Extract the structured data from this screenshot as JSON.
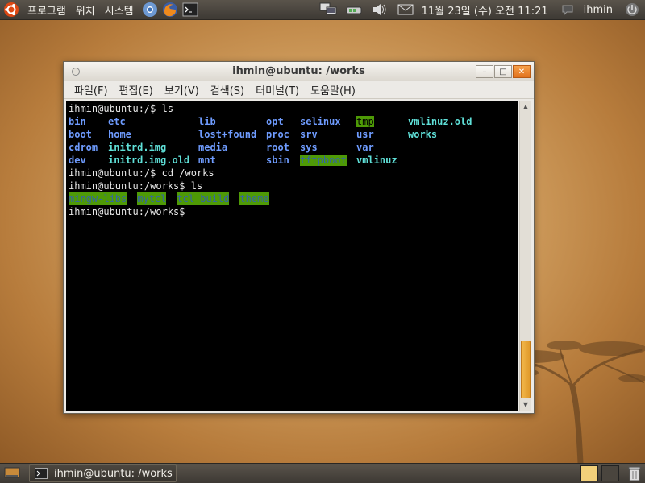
{
  "top_panel": {
    "menus": [
      "프로그램",
      "위치",
      "시스템"
    ],
    "launchers": [
      "chromium-icon",
      "firefox-icon",
      "terminal-icon"
    ],
    "tray": [
      "network-monitor-icon",
      "network-connection-icon",
      "volume-icon",
      "mail-icon"
    ],
    "clock": "11월 23일 (수) 오전 11:21",
    "user": "ihmin"
  },
  "window": {
    "title": "ihmin@ubuntu: /works",
    "menu": [
      "파일(F)",
      "편집(E)",
      "보기(V)",
      "검색(S)",
      "터미널(T)",
      "도움말(H)"
    ]
  },
  "terminal": {
    "line1": "ihmin@ubuntu:/$ ls",
    "ls_root": [
      [
        {
          "t": "bin",
          "c": "dir"
        },
        {
          "t": "etc",
          "c": "dir"
        },
        {
          "t": "lib",
          "c": "dir"
        },
        {
          "t": "opt",
          "c": "dir"
        },
        {
          "t": "selinux",
          "c": "dir"
        },
        {
          "t": "tmp",
          "c": "sticky"
        },
        {
          "t": "vmlinuz.old",
          "c": "exe"
        }
      ],
      [
        {
          "t": "boot",
          "c": "dir"
        },
        {
          "t": "home",
          "c": "dir"
        },
        {
          "t": "lost+found",
          "c": "dir"
        },
        {
          "t": "proc",
          "c": "dir"
        },
        {
          "t": "srv",
          "c": "dir"
        },
        {
          "t": "usr",
          "c": "dir"
        },
        {
          "t": "works",
          "c": "exe"
        }
      ],
      [
        {
          "t": "cdrom",
          "c": "dir"
        },
        {
          "t": "initrd.img",
          "c": "exe"
        },
        {
          "t": "media",
          "c": "dir"
        },
        {
          "t": "root",
          "c": "dir"
        },
        {
          "t": "sys",
          "c": "dir"
        },
        {
          "t": "var",
          "c": "dir"
        },
        {
          "t": "",
          "c": ""
        }
      ],
      [
        {
          "t": "dev",
          "c": "dir"
        },
        {
          "t": "initrd.img.old",
          "c": "exe"
        },
        {
          "t": "mnt",
          "c": "dir"
        },
        {
          "t": "sbin",
          "c": "dir"
        },
        {
          "t": "tftpboot",
          "c": "sticky-blue"
        },
        {
          "t": "vmlinuz",
          "c": "exe"
        },
        {
          "t": "",
          "c": ""
        }
      ]
    ],
    "line_cd": "ihmin@ubuntu:/$ cd /works",
    "line_ls2": "ihmin@ubuntu:/works$ ls",
    "ls_works": [
      "mingw-libs",
      "mytcl",
      "tcl_build",
      "theme"
    ],
    "prompt": "ihmin@ubuntu:/works$ "
  },
  "bottom_panel": {
    "task": "ihmin@ubuntu: /works"
  },
  "colors": {
    "dir": "#6f9cff",
    "exe": "#5fe0d8",
    "sticky_bg": "#4e9a06",
    "scroll_thumb": "#e19a2b"
  }
}
